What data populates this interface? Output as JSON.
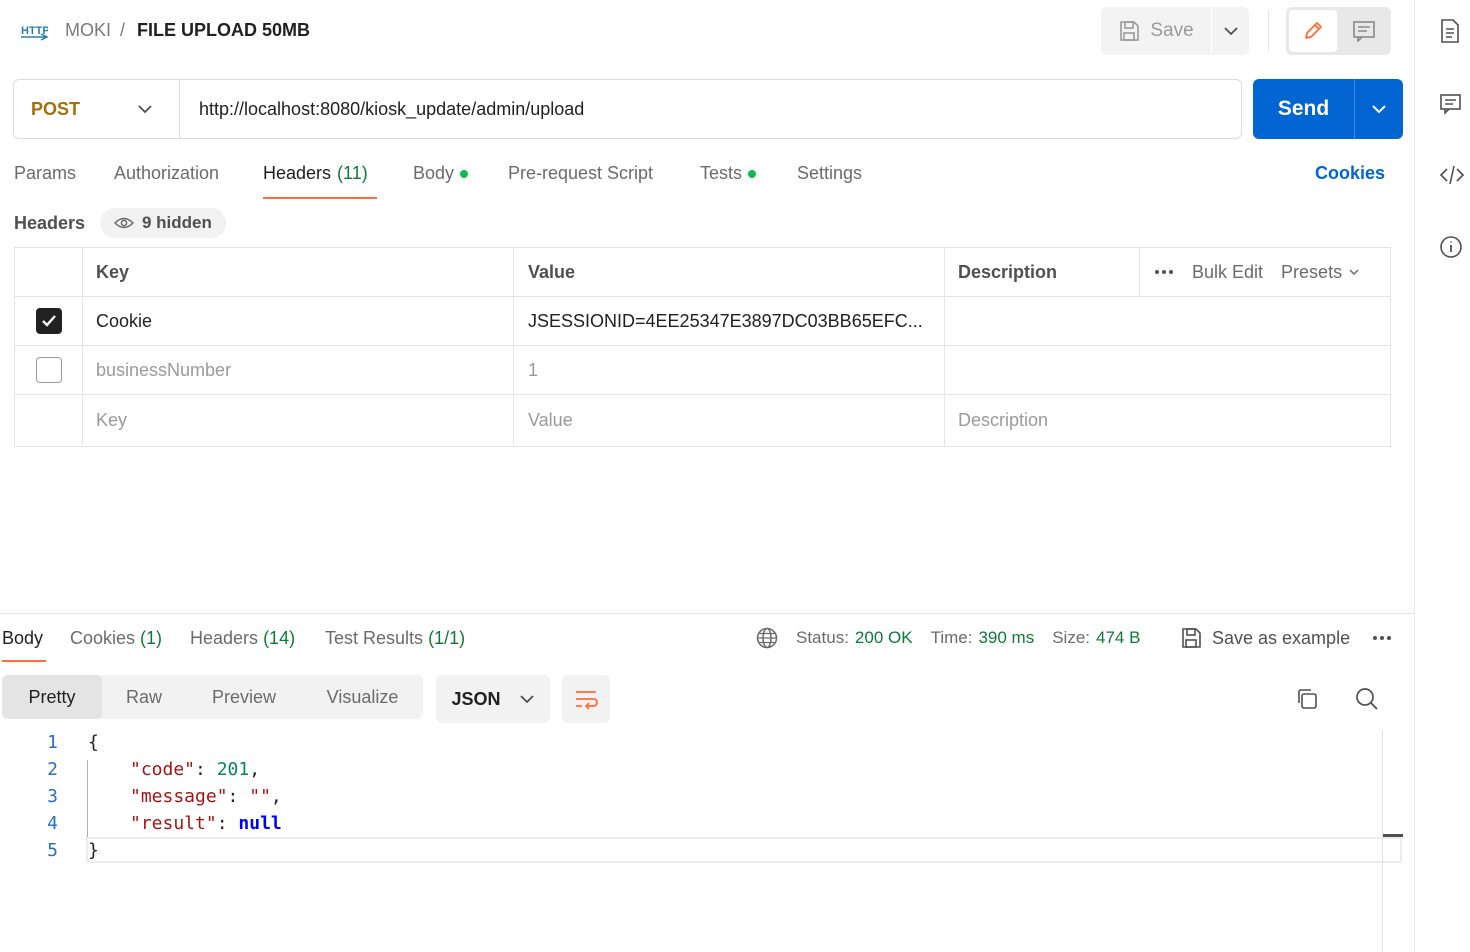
{
  "breadcrumb": {
    "protocol_icon": "http-icon",
    "collection": "MOKI",
    "separator": "/",
    "request_name": "FILE UPLOAD 50MB"
  },
  "toolbar": {
    "save_label": "Save"
  },
  "request": {
    "method": "POST",
    "url": "http://localhost:8080/kiosk_update/admin/upload",
    "send_label": "Send"
  },
  "request_tabs": [
    {
      "label": "Params"
    },
    {
      "label": "Authorization"
    },
    {
      "label": "Headers",
      "count": "(11)"
    },
    {
      "label": "Body"
    },
    {
      "label": "Pre-request Script"
    },
    {
      "label": "Tests"
    },
    {
      "label": "Settings"
    }
  ],
  "cookies_link": "Cookies",
  "headers_section": {
    "title": "Headers",
    "hidden": "9 hidden"
  },
  "headers_table": {
    "columns": [
      "Key",
      "Value",
      "Description"
    ],
    "bulk_edit": "Bulk Edit",
    "presets": "Presets",
    "rows": [
      {
        "checked": true,
        "key": "Cookie",
        "value": "JSESSIONID=4EE25347E3897DC03BB65EFC...",
        "description": ""
      },
      {
        "checked": false,
        "key": "businessNumber",
        "value": "1",
        "description": ""
      }
    ],
    "placeholders": {
      "key": "Key",
      "value": "Value",
      "description": "Description"
    }
  },
  "response_tabs": [
    {
      "label": "Body"
    },
    {
      "label": "Cookies",
      "count": "(1)"
    },
    {
      "label": "Headers",
      "count": "(14)"
    },
    {
      "label": "Test Results",
      "count": "(1/1)"
    }
  ],
  "response_meta": {
    "status_label": "Status:",
    "status_value": "200 OK",
    "time_label": "Time:",
    "time_value": "390 ms",
    "size_label": "Size:",
    "size_value": "474 B",
    "save_example": "Save as example"
  },
  "view_modes": [
    "Pretty",
    "Raw",
    "Preview",
    "Visualize"
  ],
  "format": "JSON",
  "response_body": {
    "line_numbers": [
      "1",
      "2",
      "3",
      "4",
      "5"
    ],
    "open_brace": "{",
    "close_brace": "}",
    "fields": [
      {
        "key": "\"code\"",
        "value": "201",
        "trail": ","
      },
      {
        "key": "\"message\"",
        "value": "\"\"",
        "trail": ","
      },
      {
        "key": "\"result\"",
        "value": "null",
        "trail": ""
      }
    ]
  },
  "colors": {
    "accent": "#ff6c37",
    "primary": "#0265d2",
    "method_post": "#a4700a",
    "success": "#0d7a3a"
  }
}
